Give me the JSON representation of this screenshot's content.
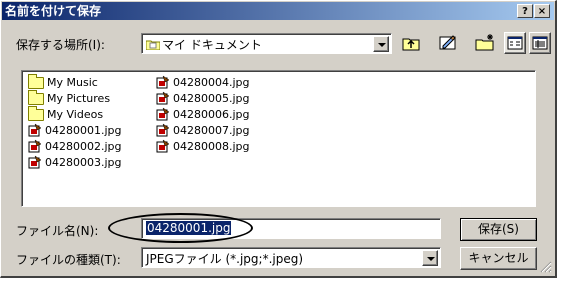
{
  "window": {
    "title": "名前を付けて保存",
    "help_button": "?",
    "close_button": "×"
  },
  "location": {
    "label": "保存する場所(I):",
    "value": "マイ ドキュメント"
  },
  "toolbar": {
    "icons": [
      "up-folder-icon",
      "desktop-icon",
      "new-folder-icon",
      "list-view-icon",
      "details-view-icon"
    ]
  },
  "files": {
    "column1": [
      {
        "name": "My Music",
        "type": "folder"
      },
      {
        "name": "My Pictures",
        "type": "folder"
      },
      {
        "name": "My Videos",
        "type": "folder"
      },
      {
        "name": "04280001.jpg",
        "type": "jpg"
      },
      {
        "name": "04280002.jpg",
        "type": "jpg"
      },
      {
        "name": "04280003.jpg",
        "type": "jpg"
      }
    ],
    "column2": [
      {
        "name": "04280004.jpg",
        "type": "jpg"
      },
      {
        "name": "04280005.jpg",
        "type": "jpg"
      },
      {
        "name": "04280006.jpg",
        "type": "jpg"
      },
      {
        "name": "04280007.jpg",
        "type": "jpg"
      },
      {
        "name": "04280008.jpg",
        "type": "jpg"
      }
    ]
  },
  "filename": {
    "label": "ファイル名(N):",
    "value": "04280001.jpg"
  },
  "filetype": {
    "label": "ファイルの種類(T):",
    "value": "JPEGファイル (*.jpg;*.jpeg)"
  },
  "buttons": {
    "save": "保存(S)",
    "cancel": "キャンセル"
  },
  "colors": {
    "title_start": "#0a246a",
    "title_end": "#a6caf0",
    "face": "#d4d0c8",
    "selection": "#0a246a"
  }
}
